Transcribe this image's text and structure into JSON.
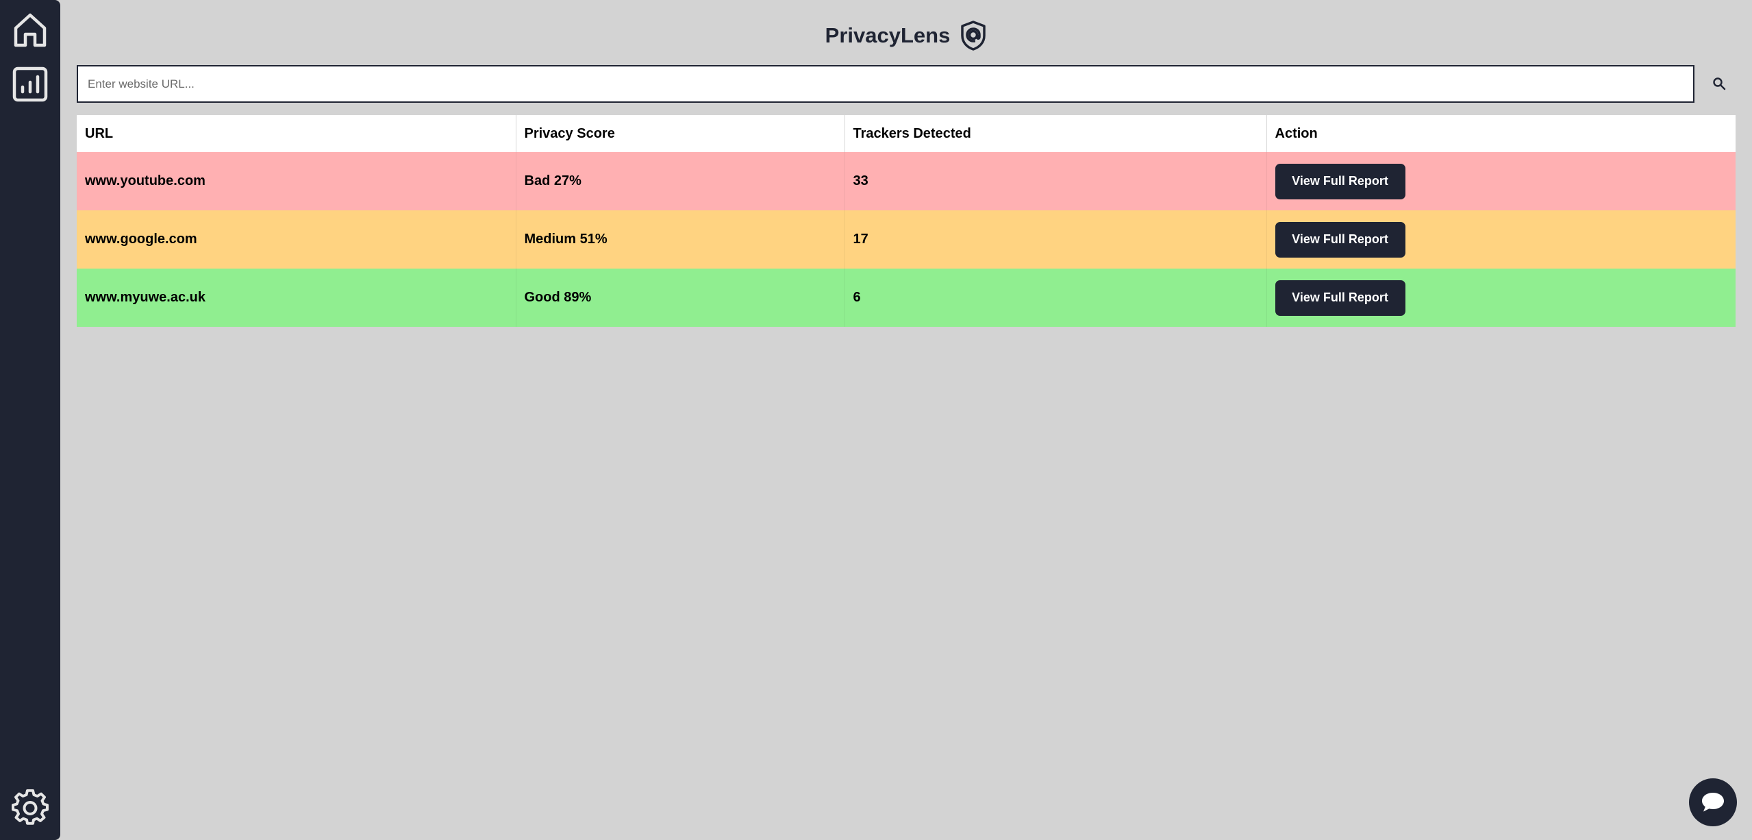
{
  "app": {
    "title": "PrivacyLens"
  },
  "sidebar": {
    "items": [
      {
        "icon": "home-icon"
      },
      {
        "icon": "bar-chart-icon"
      },
      {
        "icon": "gear-icon"
      }
    ]
  },
  "search": {
    "placeholder": "Enter website URL...",
    "value": "",
    "icon": "search-icon"
  },
  "table": {
    "headers": [
      "URL",
      "Privacy Score",
      "Trackers Detected",
      "Action"
    ],
    "rows": [
      {
        "url": "www.youtube.com",
        "score": "Bad 27%",
        "trackers": "33",
        "action": "View Full Report",
        "color": "#ffb0b2"
      },
      {
        "url": "www.google.com",
        "score": "Medium 51%",
        "trackers": "17",
        "action": "View Full Report",
        "color": "#ffd381"
      },
      {
        "url": "www.myuwe.ac.uk",
        "score": "Good 89%",
        "trackers": "6",
        "action": "View Full Report",
        "color": "#90ee90"
      }
    ]
  },
  "chat": {
    "icon": "chat-bubble-icon"
  },
  "colors": {
    "background": "#d3d3d3",
    "sidebar": "#1f2433",
    "bad": "#ffb0b2",
    "medium": "#ffd381",
    "good": "#90ee90"
  }
}
